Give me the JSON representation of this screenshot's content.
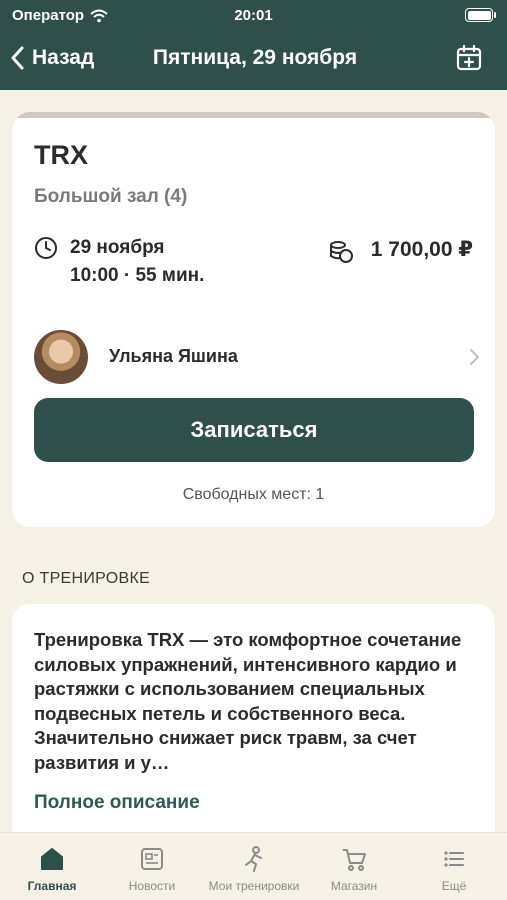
{
  "status_bar": {
    "carrier": "Оператор",
    "time": "20:01"
  },
  "nav": {
    "back_label": "Назад",
    "title": "Пятница, 29 ноября"
  },
  "class": {
    "title": "TRX",
    "room": "Большой зал (4)",
    "date": "29 ноября",
    "time": "10:00 · 55 мин.",
    "price": "1 700,00 ₽"
  },
  "trainer": {
    "name": "Ульяна Яшина"
  },
  "signup": {
    "label": "Записаться",
    "free_spots": "Свободных мест: 1"
  },
  "about": {
    "section_label": "О ТРЕНИРОВКЕ",
    "description": "Тренировка TRX — это комфортное сочетание силовых упражнений, интенсивного кардио и растяжки с использованием специальных подвесных петель и собственного веса. Значительно снижает риск травм, за счет развития и у…",
    "full_link": "Полное описание"
  },
  "tabs": [
    {
      "label": "Главная",
      "icon": "home-icon",
      "active": true
    },
    {
      "label": "Новости",
      "icon": "news-icon",
      "active": false
    },
    {
      "label": "Мои тренировки",
      "icon": "workout-icon",
      "active": false
    },
    {
      "label": "Магазин",
      "icon": "cart-icon",
      "active": false
    },
    {
      "label": "Ещё",
      "icon": "more-list-icon",
      "active": false
    }
  ],
  "colors": {
    "primary": "#2f4f4a",
    "background": "#f6f1e6",
    "card": "#ffffff"
  }
}
